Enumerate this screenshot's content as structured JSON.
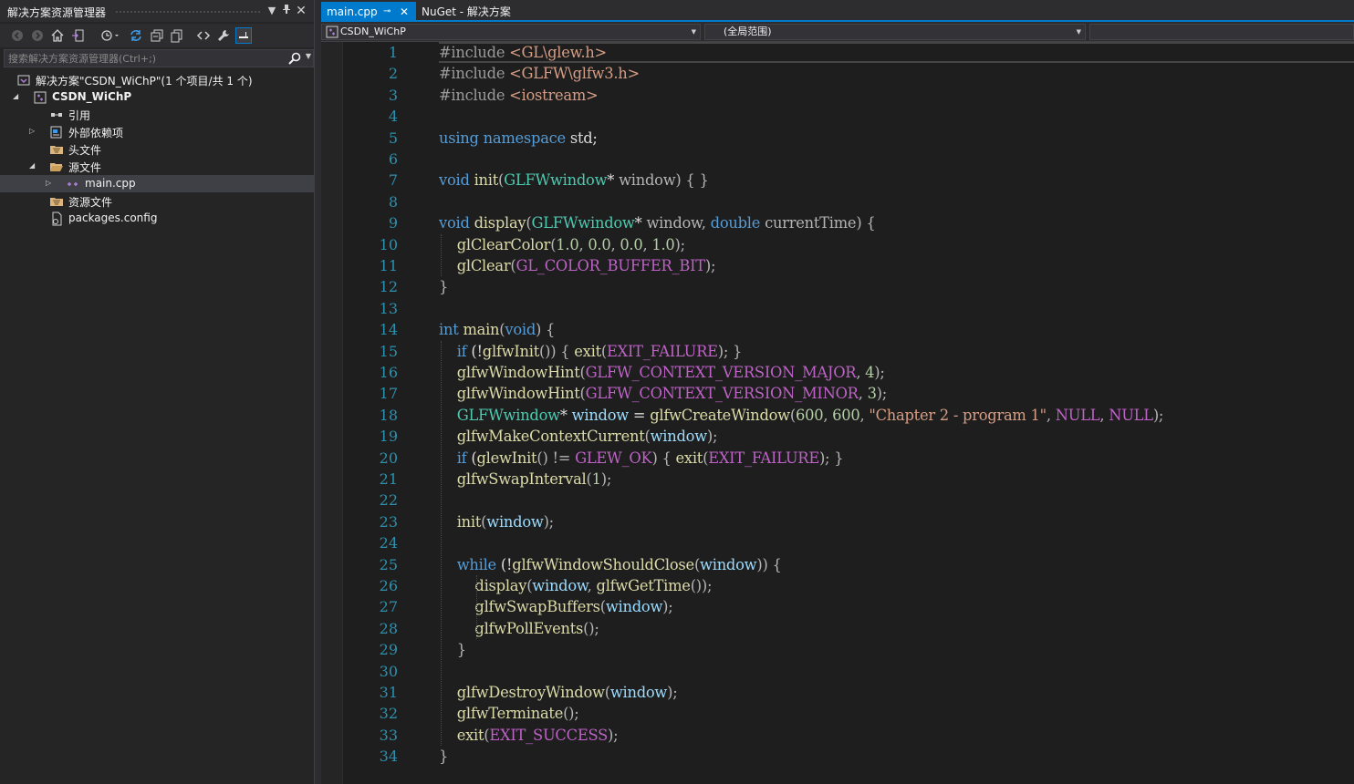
{
  "solution_explorer": {
    "title": "解决方案资源管理器",
    "search_placeholder": "搜索解决方案资源管理器(Ctrl+;)",
    "tree": [
      {
        "label": "解决方案\"CSDN_WiChP\"(1 个项目/共 1 个)",
        "icon": "solution-icon",
        "level": 0,
        "expander": "none"
      },
      {
        "label": "CSDN_WiChP",
        "icon": "cpp-project-icon",
        "level": 1,
        "expander": "expanded",
        "bold": true
      },
      {
        "label": "引用",
        "icon": "references-icon",
        "level": 2,
        "expander": "none"
      },
      {
        "label": "外部依赖项",
        "icon": "external-deps-icon",
        "level": 2,
        "expander": "collapsed"
      },
      {
        "label": "头文件",
        "icon": "filter-folder-icon",
        "level": 2,
        "expander": "none"
      },
      {
        "label": "源文件",
        "icon": "filter-folder-open-icon",
        "level": 2,
        "expander": "expanded"
      },
      {
        "label": "main.cpp",
        "icon": "cpp-file-icon",
        "level": 3,
        "expander": "collapsed",
        "selected": true
      },
      {
        "label": "资源文件",
        "icon": "filter-folder-icon",
        "level": 2,
        "expander": "none"
      },
      {
        "label": "packages.config",
        "icon": "config-file-icon",
        "level": 2,
        "expander": "none"
      }
    ]
  },
  "tabs": [
    {
      "label": "main.cpp",
      "active": true
    },
    {
      "label": "NuGet - 解决方案",
      "active": false
    }
  ],
  "navbar": {
    "project": "CSDN_WiChP",
    "scope": "(全局范围)",
    "member": ""
  },
  "editor": {
    "current_line": 1,
    "lines": [
      [
        [
          "pp",
          "#include "
        ],
        [
          "inc",
          "<GL\\glew.h>"
        ]
      ],
      [
        [
          "pp",
          "#include "
        ],
        [
          "inc",
          "<GLFW\\glfw3.h>"
        ]
      ],
      [
        [
          "pp",
          "#include "
        ],
        [
          "inc",
          "<iostream>"
        ]
      ],
      [],
      [
        [
          "kw",
          "using"
        ],
        [
          "tx",
          " "
        ],
        [
          "kw",
          "namespace"
        ],
        [
          "tx",
          " std;"
        ]
      ],
      [],
      [
        [
          "kw",
          "void"
        ],
        [
          "tx",
          " "
        ],
        [
          "fn",
          "init"
        ],
        [
          "pl",
          "("
        ],
        [
          "ty",
          "GLFWwindow"
        ],
        [
          "tx",
          "* "
        ],
        [
          "pl",
          "window"
        ],
        [
          "pl",
          ") { }"
        ]
      ],
      [],
      [
        [
          "kw",
          "void"
        ],
        [
          "tx",
          " "
        ],
        [
          "fn",
          "display"
        ],
        [
          "pl",
          "("
        ],
        [
          "ty",
          "GLFWwindow"
        ],
        [
          "tx",
          "* "
        ],
        [
          "pl",
          "window"
        ],
        [
          "pl",
          ", "
        ],
        [
          "kw",
          "double"
        ],
        [
          "tx",
          " "
        ],
        [
          "pl",
          "currentTime"
        ],
        [
          "pl",
          ") {"
        ]
      ],
      [
        [
          "tx",
          "    "
        ],
        [
          "fn",
          "glClearColor"
        ],
        [
          "pl",
          "("
        ],
        [
          "nu",
          "1.0"
        ],
        [
          "pl",
          ", "
        ],
        [
          "nu",
          "0.0"
        ],
        [
          "pl",
          ", "
        ],
        [
          "nu",
          "0.0"
        ],
        [
          "pl",
          ", "
        ],
        [
          "nu",
          "1.0"
        ],
        [
          "pl",
          ");"
        ]
      ],
      [
        [
          "tx",
          "    "
        ],
        [
          "fn",
          "glClear"
        ],
        [
          "pl",
          "("
        ],
        [
          "mc",
          "GL_COLOR_BUFFER_BIT"
        ],
        [
          "pl",
          ");"
        ]
      ],
      [
        [
          "pl",
          "}"
        ]
      ],
      [],
      [
        [
          "kw",
          "int"
        ],
        [
          "tx",
          " "
        ],
        [
          "fn",
          "main"
        ],
        [
          "pl",
          "("
        ],
        [
          "kw",
          "void"
        ],
        [
          "pl",
          ") {"
        ]
      ],
      [
        [
          "tx",
          "    "
        ],
        [
          "kw",
          "if"
        ],
        [
          "tx",
          " (!"
        ],
        [
          "fn",
          "glfwInit"
        ],
        [
          "pl",
          "()) { "
        ],
        [
          "fn",
          "exit"
        ],
        [
          "pl",
          "("
        ],
        [
          "mc",
          "EXIT_FAILURE"
        ],
        [
          "pl",
          "); }"
        ]
      ],
      [
        [
          "tx",
          "    "
        ],
        [
          "fn",
          "glfwWindowHint"
        ],
        [
          "pl",
          "("
        ],
        [
          "mc",
          "GLFW_CONTEXT_VERSION_MAJOR"
        ],
        [
          "pl",
          ", "
        ],
        [
          "nu",
          "4"
        ],
        [
          "pl",
          ");"
        ]
      ],
      [
        [
          "tx",
          "    "
        ],
        [
          "fn",
          "glfwWindowHint"
        ],
        [
          "pl",
          "("
        ],
        [
          "mc",
          "GLFW_CONTEXT_VERSION_MINOR"
        ],
        [
          "pl",
          ", "
        ],
        [
          "nu",
          "3"
        ],
        [
          "pl",
          ");"
        ]
      ],
      [
        [
          "tx",
          "    "
        ],
        [
          "ty",
          "GLFWwindow"
        ],
        [
          "tx",
          "* "
        ],
        [
          "pa",
          "window"
        ],
        [
          "tx",
          " = "
        ],
        [
          "fn",
          "glfwCreateWindow"
        ],
        [
          "pl",
          "("
        ],
        [
          "nu",
          "600"
        ],
        [
          "pl",
          ", "
        ],
        [
          "nu",
          "600"
        ],
        [
          "pl",
          ", "
        ],
        [
          "st",
          "\"Chapter 2 - program 1\""
        ],
        [
          "pl",
          ", "
        ],
        [
          "mc",
          "NULL"
        ],
        [
          "pl",
          ", "
        ],
        [
          "mc",
          "NULL"
        ],
        [
          "pl",
          ");"
        ]
      ],
      [
        [
          "tx",
          "    "
        ],
        [
          "fn",
          "glfwMakeContextCurrent"
        ],
        [
          "pl",
          "("
        ],
        [
          "pa",
          "window"
        ],
        [
          "pl",
          ");"
        ]
      ],
      [
        [
          "tx",
          "    "
        ],
        [
          "kw",
          "if"
        ],
        [
          "tx",
          " ("
        ],
        [
          "fn",
          "glewInit"
        ],
        [
          "pl",
          "() != "
        ],
        [
          "mc",
          "GLEW_OK"
        ],
        [
          "pl",
          ") { "
        ],
        [
          "fn",
          "exit"
        ],
        [
          "pl",
          "("
        ],
        [
          "mc",
          "EXIT_FAILURE"
        ],
        [
          "pl",
          "); }"
        ]
      ],
      [
        [
          "tx",
          "    "
        ],
        [
          "fn",
          "glfwSwapInterval"
        ],
        [
          "pl",
          "("
        ],
        [
          "nu",
          "1"
        ],
        [
          "pl",
          ");"
        ]
      ],
      [],
      [
        [
          "tx",
          "    "
        ],
        [
          "fn",
          "init"
        ],
        [
          "pl",
          "("
        ],
        [
          "pa",
          "window"
        ],
        [
          "pl",
          ");"
        ]
      ],
      [],
      [
        [
          "tx",
          "    "
        ],
        [
          "kw",
          "while"
        ],
        [
          "tx",
          " (!"
        ],
        [
          "fn",
          "glfwWindowShouldClose"
        ],
        [
          "pl",
          "("
        ],
        [
          "pa",
          "window"
        ],
        [
          "pl",
          ")) {"
        ]
      ],
      [
        [
          "tx",
          "        "
        ],
        [
          "fn",
          "display"
        ],
        [
          "pl",
          "("
        ],
        [
          "pa",
          "window"
        ],
        [
          "pl",
          ", "
        ],
        [
          "fn",
          "glfwGetTime"
        ],
        [
          "pl",
          "());"
        ]
      ],
      [
        [
          "tx",
          "        "
        ],
        [
          "fn",
          "glfwSwapBuffers"
        ],
        [
          "pl",
          "("
        ],
        [
          "pa",
          "window"
        ],
        [
          "pl",
          ");"
        ]
      ],
      [
        [
          "tx",
          "        "
        ],
        [
          "fn",
          "glfwPollEvents"
        ],
        [
          "pl",
          "();"
        ]
      ],
      [
        [
          "tx",
          "    "
        ],
        [
          "pl",
          "}"
        ]
      ],
      [],
      [
        [
          "tx",
          "    "
        ],
        [
          "fn",
          "glfwDestroyWindow"
        ],
        [
          "pl",
          "("
        ],
        [
          "pa",
          "window"
        ],
        [
          "pl",
          ");"
        ]
      ],
      [
        [
          "tx",
          "    "
        ],
        [
          "fn",
          "glfwTerminate"
        ],
        [
          "pl",
          "();"
        ]
      ],
      [
        [
          "tx",
          "    "
        ],
        [
          "fn",
          "exit"
        ],
        [
          "pl",
          "("
        ],
        [
          "mc",
          "EXIT_SUCCESS"
        ],
        [
          "pl",
          ");"
        ]
      ],
      [
        [
          "pl",
          "}"
        ]
      ]
    ]
  },
  "colors": {
    "accent": "#007acc",
    "background": "#1e1e1e",
    "line_number": "#2b91af",
    "keyword": "#569cd6",
    "function": "#dcdcaa",
    "type": "#4ec9b0",
    "macro": "#bd63c5",
    "string": "#d69d85",
    "number": "#b5cea8",
    "parameter": "#9cdcfe"
  }
}
